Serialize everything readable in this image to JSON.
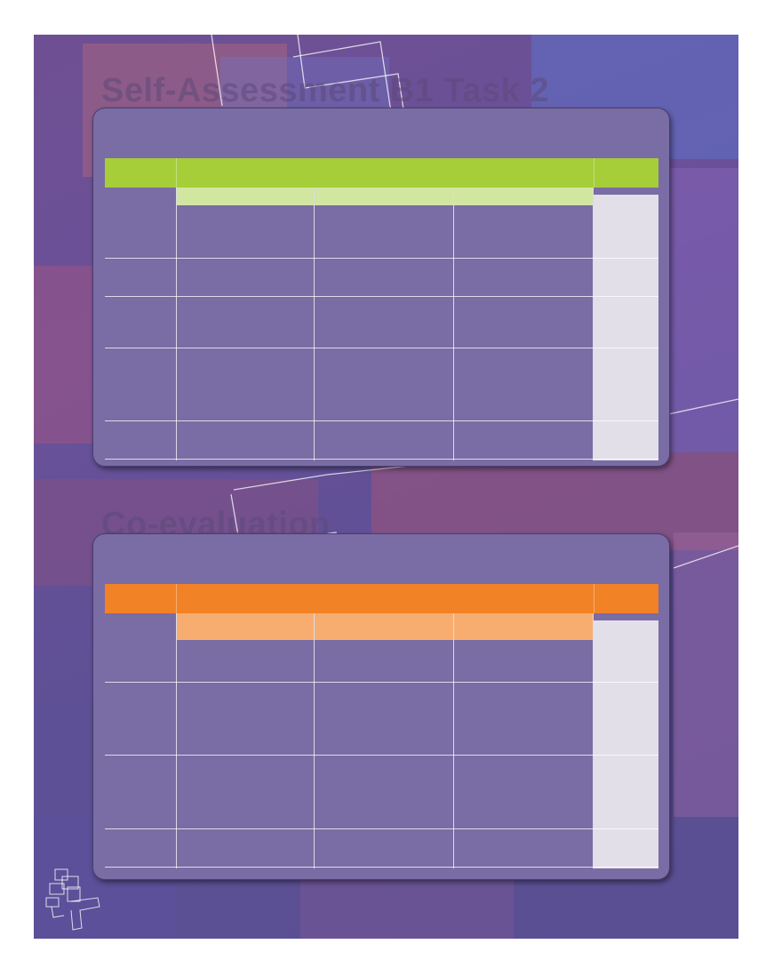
{
  "self_assessment": {
    "heading": "Self-Assessment B1 Task 2",
    "header_color": "#a6ce39",
    "subheader_color": "#d1e6a0",
    "score_column_color": "#e2dfe9"
  },
  "co_evaluation": {
    "heading": "Co-evaluation",
    "header_color": "#f18226",
    "subheader_color": "#f7ad70",
    "score_column_color": "#e2dfe9"
  },
  "colors": {
    "panel": "#7a6ca4",
    "page": "#5f5096"
  }
}
